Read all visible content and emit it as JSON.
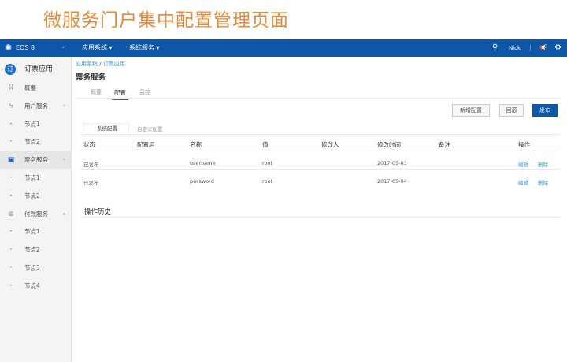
{
  "slide_title": "微服务门户集中配置管理页面",
  "nav": {
    "brand": "EOS 8",
    "menus": [
      "应用系统 ▾",
      "系统服务 ▾"
    ],
    "user": "Nick"
  },
  "sidebar": {
    "app": "订票应用",
    "items": [
      {
        "label": "概要",
        "type": "item",
        "icon": "grid-icon"
      },
      {
        "label": "用户服务",
        "type": "group",
        "icon": "bolt-icon"
      },
      {
        "label": "节点1",
        "type": "sub"
      },
      {
        "label": "节点2",
        "type": "sub"
      },
      {
        "label": "票务服务",
        "type": "group",
        "icon": "cube-icon",
        "active": true
      },
      {
        "label": "节点1",
        "type": "sub"
      },
      {
        "label": "节点2",
        "type": "sub"
      },
      {
        "label": "付款服务",
        "type": "group",
        "icon": "globe-icon"
      },
      {
        "label": "节点1",
        "type": "sub"
      },
      {
        "label": "节点2",
        "type": "sub"
      },
      {
        "label": "节点3",
        "type": "sub"
      },
      {
        "label": "节点4",
        "type": "sub"
      }
    ]
  },
  "breadcrumb": {
    "root": "应用系统",
    "sep": " / ",
    "current": "订票应用"
  },
  "page_title": "票务服务",
  "tabs": [
    "概要",
    "配置",
    "监控"
  ],
  "buttons": {
    "add": "新增配置",
    "rollback": "回滚",
    "publish": "发布"
  },
  "subtabs": [
    "系统配置",
    "自定义配置"
  ],
  "table": {
    "headers": [
      "状态",
      "配置组",
      "名称",
      "值",
      "修改人",
      "修改时间",
      "备注",
      "操作"
    ],
    "rows": [
      {
        "status": "已发布",
        "group": "",
        "name": "username",
        "value": "root",
        "modifier": "",
        "time": "2017-05-03",
        "note": "",
        "edit": "编辑",
        "delete": "删除"
      },
      {
        "status": "已发布",
        "group": "",
        "name": "password",
        "value": "root",
        "modifier": "",
        "time": "2017-05-04",
        "note": "",
        "edit": "编辑",
        "delete": "删除"
      }
    ]
  },
  "history_title": "操作历史",
  "colors": {
    "nav": "#0e56a8",
    "accent": "#e8893a",
    "link": "#3a9ad9"
  }
}
